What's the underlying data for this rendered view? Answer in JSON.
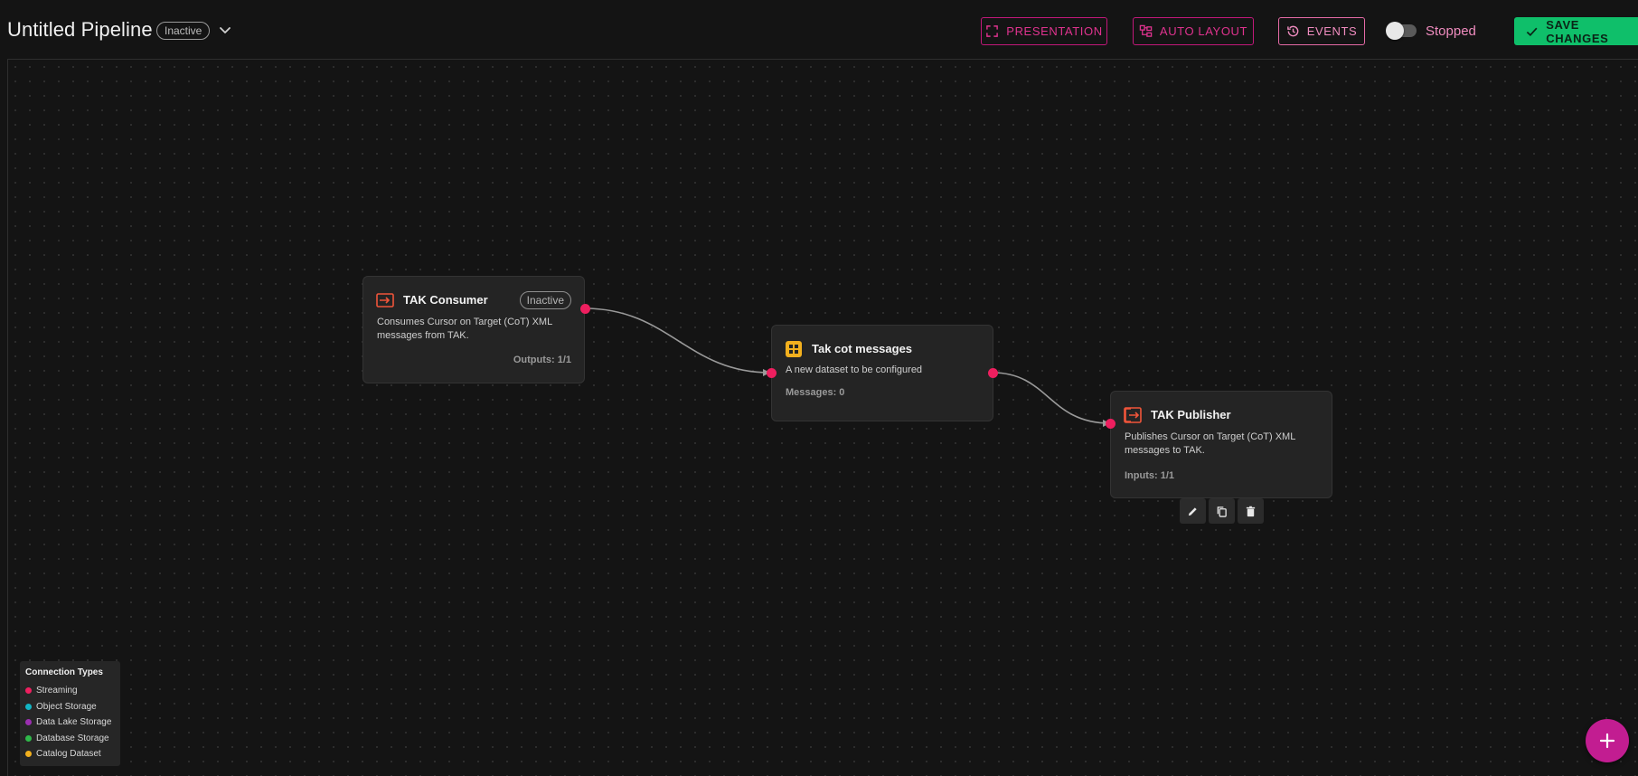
{
  "header": {
    "title": "Untitled Pipeline",
    "status": "Inactive",
    "presentation_label": "PRESENTATION",
    "auto_layout_label": "AUTO LAYOUT",
    "events_label": "EVENTS",
    "toggle_label": "Stopped",
    "toggle_on": false,
    "save_label": "SAVE CHANGES"
  },
  "nodes": [
    {
      "title": "TAK Consumer",
      "badge": "Inactive",
      "description": "Consumes Cursor on Target (CoT) XML messages from TAK.",
      "meta": "Outputs: 1/1",
      "icon": "input-arrow-icon"
    },
    {
      "title": "Tak cot messages",
      "description": "A new dataset to be configured",
      "meta": "Messages: 0",
      "icon": "dataset-grid-icon"
    },
    {
      "title": "TAK Publisher",
      "description": "Publishes Cursor on Target (CoT) XML messages to TAK.",
      "meta": "Inputs: 1/1",
      "icon": "output-arrow-icon"
    }
  ],
  "node_tools": [
    "edit-icon",
    "copy-icon",
    "delete-icon"
  ],
  "legend": {
    "title": "Connection Types",
    "items": [
      {
        "label": "Streaming",
        "color": "#ee1f5f"
      },
      {
        "label": "Object Storage",
        "color": "#12b5c4"
      },
      {
        "label": "Data Lake Storage",
        "color": "#9b2fb0"
      },
      {
        "label": "Database Storage",
        "color": "#2fb84a"
      },
      {
        "label": "Catalog Dataset",
        "color": "#f2b01e"
      }
    ]
  },
  "colors": {
    "accent": "#e0338f",
    "save": "#0fbf6a",
    "streaming_port": "#ee1f5f",
    "fab": "#c21d91"
  }
}
